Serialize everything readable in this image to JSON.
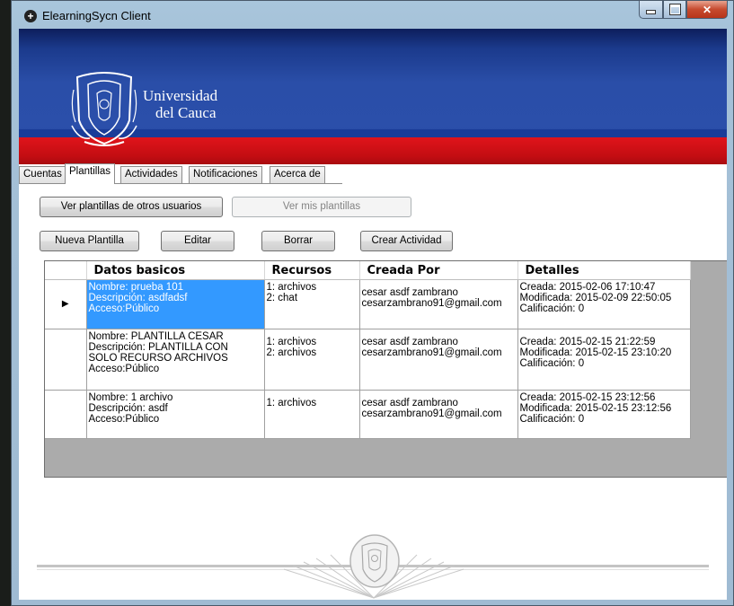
{
  "window": {
    "title": "ElearningSycn Client",
    "icon": "+"
  },
  "banner": {
    "line1": "Universidad",
    "line2": "del Cauca"
  },
  "tabs": [
    "Cuentas",
    "Plantillas",
    "Actividades",
    "Notificaciones",
    "Acerca de"
  ],
  "active_tab": "Plantillas",
  "buttons": {
    "ver_otros": "Ver plantillas de otros usuarios",
    "ver_mis": "Ver mis plantillas",
    "nueva": "Nueva Plantilla",
    "editar": "Editar",
    "borrar": "Borrar",
    "crear_actividad": "Crear Actividad"
  },
  "grid": {
    "columns": [
      "Datos basicos",
      "Recursos",
      "Creada Por",
      "Detalles"
    ],
    "row_indicator": "▶",
    "rows": [
      {
        "datos": "Nombre: prueba 101\nDescripción: asdfadsf\nAcceso:Público",
        "recursos": "1: archivos\n2: chat",
        "creada": "cesar asdf zambrano\ncesarzambrano91@gmail.com",
        "detalles": "Creada: 2015-02-06 17:10:47\nModificada: 2015-02-09 22:50:05\nCalificación: 0"
      },
      {
        "datos": "Nombre: PLANTILLA CESAR\nDescripción: PLANTILLA CON\nSOLO RECURSO ARCHIVOS\nAcceso:Público",
        "recursos": "1: archivos\n2: archivos",
        "creada": "cesar asdf zambrano\ncesarzambrano91@gmail.com",
        "detalles": "Creada: 2015-02-15 21:22:59\nModificada: 2015-02-15 23:10:20\nCalificación: 0"
      },
      {
        "datos": "Nombre: 1 archivo\nDescripción: asdf\nAcceso:Público",
        "recursos": "1: archivos",
        "creada": "cesar asdf zambrano\ncesarzambrano91@gmail.com",
        "detalles": "Creada: 2015-02-15 23:12:56\nModificada: 2015-02-15 23:12:56\nCalificación: 0"
      }
    ]
  },
  "colors": {
    "banner_blue": "#2b4faa",
    "banner_red": "#d1111a",
    "selection": "#3399ff"
  }
}
